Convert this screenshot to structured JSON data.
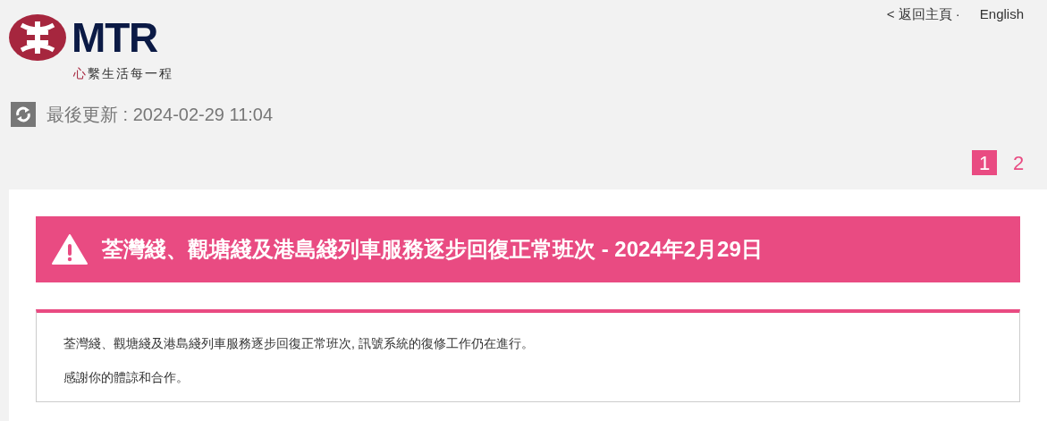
{
  "header": {
    "logo_text": "MTR",
    "tagline_mark": "心",
    "tagline_rest": "繫生活每一程",
    "links": [
      {
        "label": "< 返回主頁 ·"
      },
      {
        "label": "English"
      }
    ]
  },
  "last_updated": "最後更新 : 2024-02-29 11:04",
  "pages": [
    {
      "label": "1",
      "selected": true
    },
    {
      "label": "2",
      "selected": false
    }
  ],
  "notice": {
    "title": "荃灣綫、觀塘綫及港島綫列車服務逐步回復正常班次 - 2024年2月29日",
    "paragraphs": [
      "荃灣綫、觀塘綫及港島綫列車服務逐步回復正常班次, 訊號系統的復修工作仍在進行。",
      "感謝你的體諒和合作。"
    ]
  }
}
